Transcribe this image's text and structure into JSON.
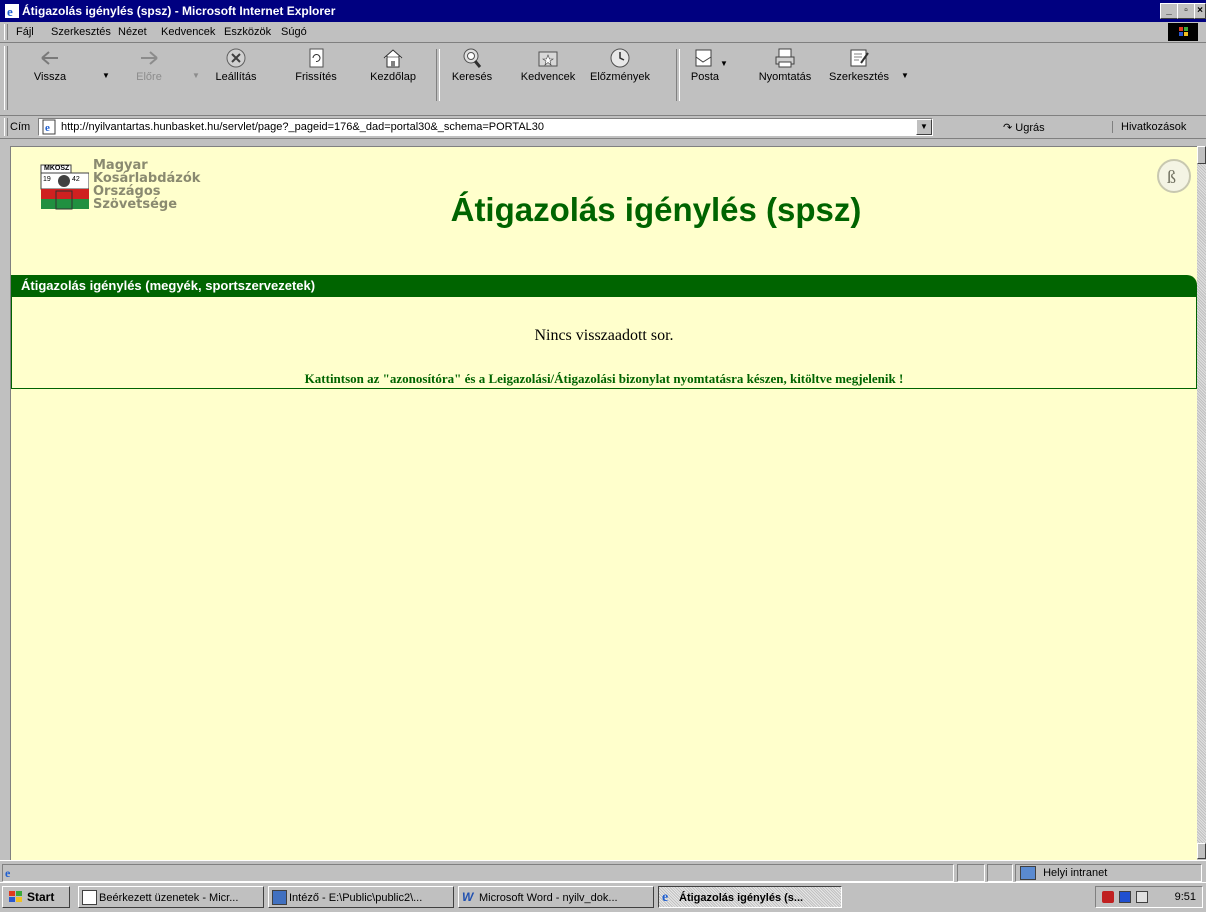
{
  "window": {
    "title": "Átigazolás igénylés (spsz) - Microsoft Internet Explorer"
  },
  "menu": [
    "Fájl",
    "Szerkesztés",
    "Nézet",
    "Kedvencek",
    "Eszközök",
    "Súgó"
  ],
  "toolbar": {
    "back": "Vissza",
    "forward": "Előre",
    "stop": "Leállítás",
    "refresh": "Frissítés",
    "home": "Kezdőlap",
    "search": "Keresés",
    "favorites": "Kedvencek",
    "history": "Előzmények",
    "mail": "Posta",
    "print": "Nyomtatás",
    "edit": "Szerkesztés"
  },
  "address": {
    "label": "Cím",
    "url": "http://nyilvantartas.hunbasket.hu/servlet/page?_pageid=176&_dad=portal30&_schema=PORTAL30",
    "go": "Ugrás",
    "links": "Hivatkozások"
  },
  "page": {
    "logo_lines": [
      "Magyar",
      "Kosárlabdázók",
      "Országos",
      "Szövetsége"
    ],
    "logo_badge": "MKOSZ",
    "logo_years": [
      "19",
      "42"
    ],
    "title": "Átigazolás igénylés (spsz)",
    "portlet_title": "Átigazolás igénylés (megyék, sportszervezetek)",
    "no_rows": "Nincs visszaadott sor.",
    "hint": "Kattintson az \"azonosítóra\" és a Leigazolási/Átigazolási bizonylat nyomtatásra készen, kitöltve megjelenik !"
  },
  "status": {
    "zone": "Helyi intranet"
  },
  "taskbar": {
    "start": "Start",
    "tasks": [
      "Beérkezett üzenetek - Micr...",
      "Intéző - E:\\Public\\public2\\...",
      "Microsoft Word - nyilv_dok...",
      "Átigazolás igénylés (s..."
    ],
    "clock": "9:51"
  }
}
